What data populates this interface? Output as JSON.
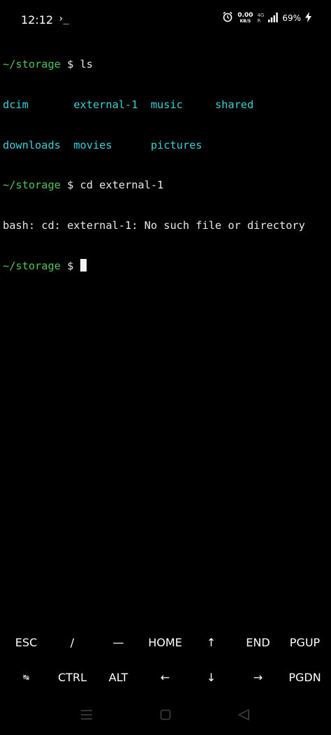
{
  "status_bar": {
    "time": "12:12",
    "terminal_indicator": "›_",
    "speed_value": "0.00",
    "speed_unit": "KB/S",
    "network_type": "4G",
    "network_sub": "R",
    "battery": "69%"
  },
  "terminal": {
    "lines": [
      {
        "prompt": "~/storage",
        "rest": " $ ls"
      },
      {
        "dirs": [
          "dcim      ",
          " external-1",
          "  music    ",
          " shared"
        ]
      },
      {
        "dirs": [
          "downloads ",
          " movies    ",
          "  pictures"
        ]
      },
      {
        "prompt": "~/storage",
        "rest": " $ cd external-1"
      },
      {
        "text": "bash: cd: external-1: No such file or directory"
      },
      {
        "prompt": "~/storage",
        "rest": " $ "
      }
    ]
  },
  "extra_keys": {
    "row1": [
      "ESC",
      "/",
      "—",
      "HOME",
      "↑",
      "END",
      "PGUP"
    ],
    "row2": [
      "↹",
      "CTRL",
      "ALT",
      "←",
      "↓",
      "→",
      "PGDN"
    ]
  },
  "colors": {
    "background": "#000000",
    "prompt": "#4fc25a",
    "directory": "#3ccfd8",
    "text": "#e8e8e8"
  }
}
